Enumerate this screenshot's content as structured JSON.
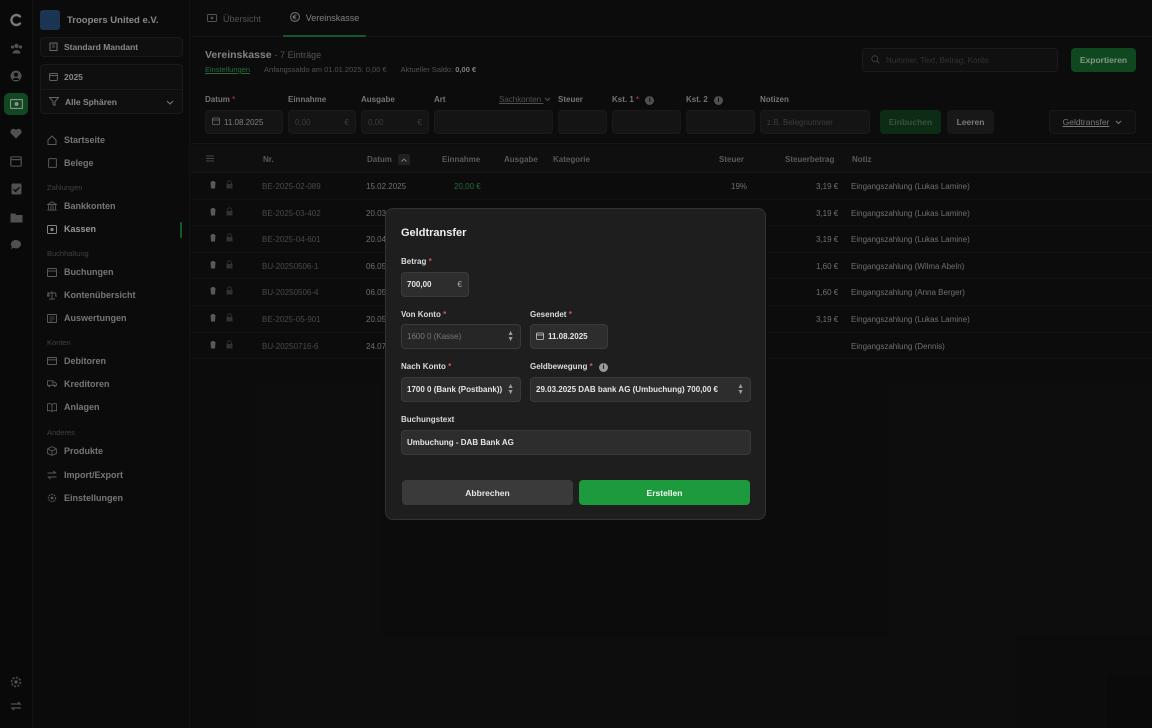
{
  "sidebar": {
    "org_name": "Troopers United e.V.",
    "mandant": "Standard Mandant",
    "year": "2025",
    "sphere": "Alle Sphären",
    "sections": {
      "zahlungen": "Zahlungen",
      "buchhaltung": "Buchhaltung",
      "konten": "Konten",
      "anderes": "Anderes"
    },
    "items": {
      "startseite": "Startseite",
      "belege": "Belege",
      "bankkonten": "Bankkonten",
      "kassen": "Kassen",
      "buchungen": "Buchungen",
      "kontenuebersicht": "Kontenübersicht",
      "auswertungen": "Auswertungen",
      "debitoren": "Debitoren",
      "kreditoren": "Kreditoren",
      "anlagen": "Anlagen",
      "produkte": "Produkte",
      "import_export": "Import/Export",
      "einstellungen": "Einstellungen"
    }
  },
  "tabs": {
    "uebersicht": "Übersicht",
    "vereinskasse": "Vereinskasse"
  },
  "header": {
    "title": "Vereinskasse",
    "count": "- 7 Einträge",
    "settings_link": "Einstellungen",
    "opening_balance": "Anfangssaldo am 01.01.2025: 0,00 €",
    "current_balance_label": "Aktueller Saldo:",
    "current_balance_value": "0,00 €",
    "search_placeholder": "Nummer, Text, Betrag, Konto",
    "export": "Exportieren"
  },
  "entry": {
    "datum_label": "Datum",
    "datum_value": "11.08.2025",
    "einnahme_label": "Einnahme",
    "einnahme_ph": "0,00",
    "ausgabe_label": "Ausgabe",
    "ausgabe_ph": "0,00",
    "art_label": "Art",
    "sachkonten": "Sachkonten",
    "steuer_label": "Steuer",
    "kst1_label": "Kst. 1",
    "kst2_label": "Kst. 2",
    "notizen_label": "Notizen",
    "notizen_ph": "z.B. Belegnummer",
    "einbuchen": "Einbuchen",
    "leeren": "Leeren",
    "geldtransfer": "Geldtransfer",
    "currency": "€"
  },
  "table": {
    "headers": [
      "Nr.",
      "Datum",
      "Einnahme",
      "Ausgabe",
      "Kategorie",
      "Steuer",
      "Steuerbetrag",
      "Notiz"
    ],
    "rows": [
      {
        "nr": "BE-2025-02-089",
        "datum": "15.02.2025",
        "einnahme": "20,00 €",
        "steuer": "19%",
        "steuerbetrag": "3,19 €",
        "notiz": "Eingangszahlung (Lukas Lamine)"
      },
      {
        "nr": "BE-2025-03-402",
        "datum": "20.03",
        "einnahme": "",
        "steuer": "",
        "steuerbetrag": "3,19 €",
        "notiz": "Eingangszahlung (Lukas Lamine)"
      },
      {
        "nr": "BE-2025-04-601",
        "datum": "20.04",
        "einnahme": "",
        "steuer": "",
        "steuerbetrag": "3,19 €",
        "notiz": "Eingangszahlung (Lukas Lamine)"
      },
      {
        "nr": "BU-20250506-1",
        "datum": "06.05",
        "einnahme": "",
        "steuer": "",
        "steuerbetrag": "1,60 €",
        "notiz": "Eingangszahlung (Wilma Abeln)"
      },
      {
        "nr": "BU-20250506-4",
        "datum": "06.05",
        "einnahme": "",
        "steuer": "",
        "steuerbetrag": "1,60 €",
        "notiz": "Eingangszahlung (Anna Berger)"
      },
      {
        "nr": "BE-2025-05-901",
        "datum": "20.05",
        "einnahme": "",
        "steuer": "",
        "steuerbetrag": "3,19 €",
        "notiz": "Eingangszahlung (Lukas Lamine)"
      },
      {
        "nr": "BU-20250716-6",
        "datum": "24.07",
        "einnahme": "",
        "steuer": "",
        "steuerbetrag": "",
        "notiz": "Eingangszahlung (Dennis)"
      }
    ]
  },
  "modal": {
    "title": "Geldtransfer",
    "betrag_label": "Betrag",
    "betrag_value": "700,00",
    "currency": "€",
    "von_konto_label": "Von Konto",
    "von_konto_value": "1600 0 (Kasse)",
    "gesendet_label": "Gesendet",
    "gesendet_value": "11.08.2025",
    "nach_konto_label": "Nach Konto",
    "nach_konto_value": "1700 0 (Bank (Postbank))",
    "geldbewegung_label": "Geldbewegung",
    "geldbewegung_value": "29.03.2025 DAB bank AG (Umbuchung) 700,00 €",
    "buchungstext_label": "Buchungstext",
    "buchungstext_value": "Umbuchung - DAB Bank AG",
    "cancel": "Abbrechen",
    "create": "Erstellen"
  }
}
